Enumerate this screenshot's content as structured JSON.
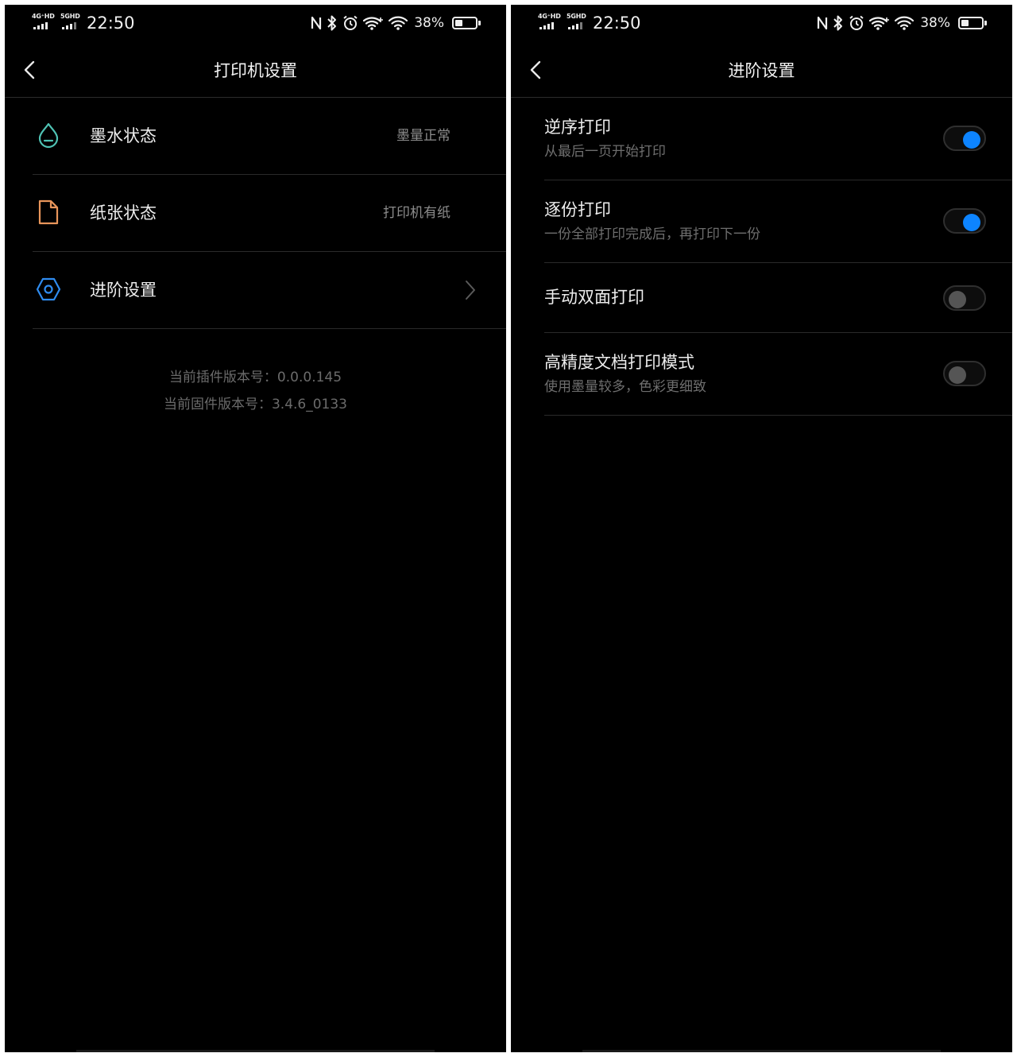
{
  "status_bar": {
    "network_1": "4G⁺HD",
    "network_2": "5GHD",
    "time": "22:50",
    "battery_percent": "38%",
    "battery_level": 0.38
  },
  "left_screen": {
    "title": "打印机设置",
    "items": [
      {
        "label": "墨水状态",
        "value": "墨量正常",
        "icon": "ink-drop-icon",
        "icon_color": "#4fc3b4"
      },
      {
        "label": "纸张状态",
        "value": "打印机有纸",
        "icon": "paper-icon",
        "icon_color": "#e8955a"
      },
      {
        "label": "进阶设置",
        "value": "",
        "icon": "hexagon-settings-icon",
        "icon_color": "#2f8cf0"
      }
    ],
    "plugin_version": "当前插件版本号：0.0.0.145",
    "firmware_version": "当前固件版本号：3.4.6_0133"
  },
  "right_screen": {
    "title": "进阶设置",
    "settings": [
      {
        "title": "逆序打印",
        "subtitle": "从最后一页开始打印",
        "enabled": true
      },
      {
        "title": "逐份打印",
        "subtitle": "一份全部打印完成后，再打印下一份",
        "enabled": true
      },
      {
        "title": "手动双面打印",
        "subtitle": "",
        "enabled": false
      },
      {
        "title": "高精度文档打印模式",
        "subtitle": "使用墨量较多，色彩更细致",
        "enabled": false
      }
    ]
  },
  "colors": {
    "background": "#000000",
    "toggle_on": "#0d84ff",
    "toggle_off_knob": "#555555"
  }
}
